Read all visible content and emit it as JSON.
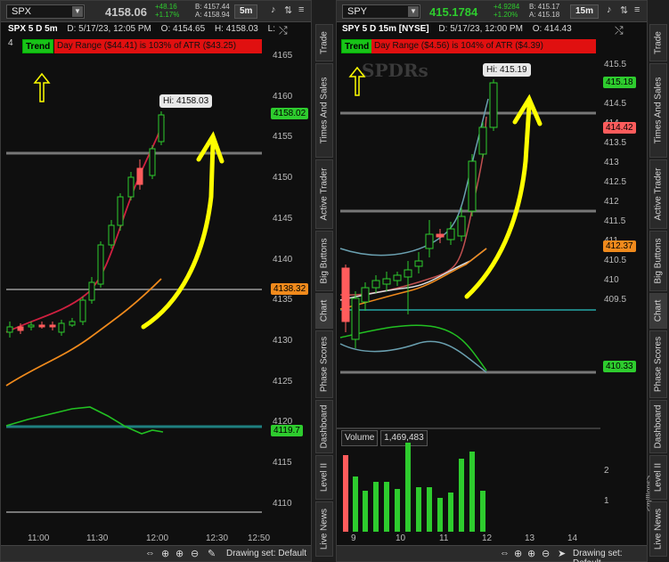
{
  "left": {
    "symbol": "SPX",
    "price": "4158.06",
    "change": "+48.16",
    "change_pct": "+1.17%",
    "bid": "B: 4157.44",
    "ask": "A: 4158.94",
    "timeframe": "5m",
    "info": {
      "title": "SPX 5 D 5m",
      "date": "D: 5/17/23, 12:05 PM",
      "open": "O: 4154.65",
      "high": "H: 4158.03",
      "low": "L: 4"
    },
    "trend_label": "Trend",
    "day_range": "Day Range ($44.41) is 103% of ATR ($43.25)",
    "hi_label": "Hi: 4158.03",
    "y_ticks": [
      "4165",
      "4160",
      "4155",
      "4150",
      "4145",
      "4140",
      "4135",
      "4130",
      "4125",
      "4120",
      "4115",
      "4110"
    ],
    "x_ticks": [
      "11:00",
      "11:30",
      "12:00",
      "12:30",
      "12:50"
    ],
    "tags": {
      "last": "4158.02",
      "orange": "4138.32",
      "green": "4119.7"
    },
    "drawing_set": "Drawing set: Default"
  },
  "right": {
    "symbol": "SPY",
    "price": "415.1784",
    "change": "+4.9284",
    "change_pct": "+1.20%",
    "bid": "B: 415.17",
    "ask": "A: 415.18",
    "timeframe": "15m",
    "info": {
      "title": "SPY 5 D 15m [NYSE]",
      "date": "D: 5/17/23, 12:00 PM",
      "open": "O: 414.43"
    },
    "trend_label": "Trend",
    "day_range": "Day Range ($4.56) is 104% of ATR ($4.39)",
    "hi_label": "Hi: 415.19",
    "watermark": "SPDRs",
    "y_ticks": [
      "415.5",
      "415",
      "414.5",
      "414",
      "413.5",
      "413",
      "412.5",
      "412",
      "411.5",
      "411",
      "410.5",
      "410",
      "409.5"
    ],
    "x_ticks": [
      "9",
      "10",
      "11",
      "12",
      "13",
      "14"
    ],
    "tags": {
      "last": "415.18",
      "red": "414.42",
      "orange": "412.37",
      "green": "410.33"
    },
    "volume_label": "Volume",
    "volume_value": "1,469,483",
    "volume_ticks": [
      "2",
      "1"
    ],
    "volume_unit": "<millions>",
    "drawing_set": "Drawing set: Default"
  },
  "side_tabs": [
    "Trade",
    "Times And Sales",
    "Active Trader",
    "Big Buttons",
    "Chart",
    "Phase Scores",
    "Dashboard",
    "Level II",
    "Live News"
  ],
  "colors": {
    "up": "#2ecc2e",
    "down": "#ff5c5c",
    "trend": "#18c318",
    "day_range": "#e01010",
    "annotation": "#ffff00",
    "teal_line": "#1f8080",
    "orange_line": "#f08a1c"
  }
}
